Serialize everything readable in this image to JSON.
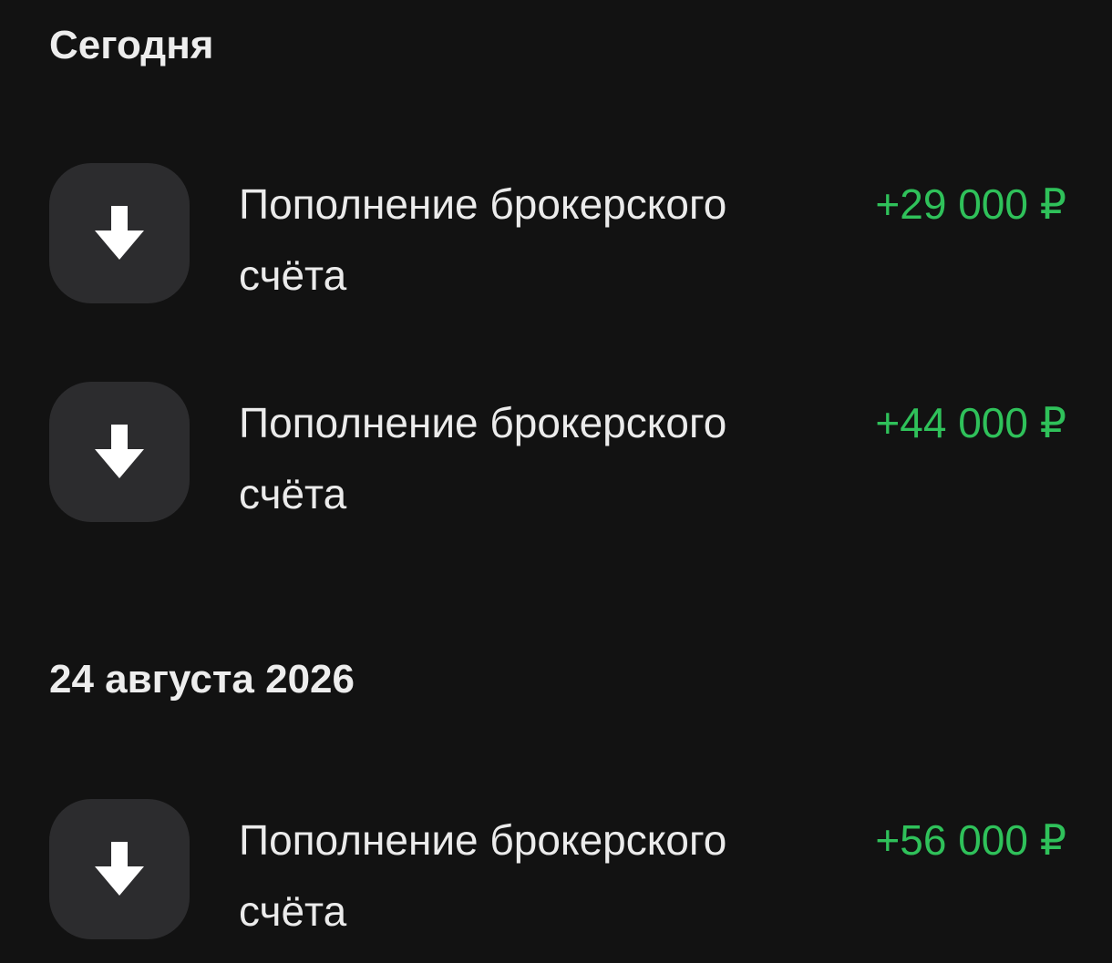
{
  "sections": [
    {
      "header": "Сегодня",
      "operations": [
        {
          "title": "Пополнение брокерского счёта",
          "amount": "+29 000 ₽",
          "icon": "arrow-down-icon"
        },
        {
          "title": "Пополнение брокерского счёта",
          "amount": "+44 000 ₽",
          "icon": "arrow-down-icon"
        }
      ]
    },
    {
      "header": "24 августа 2026",
      "operations": [
        {
          "title": "Пополнение брокерского счёта",
          "amount": "+56 000 ₽",
          "icon": "arrow-down-icon"
        }
      ]
    }
  ],
  "colors": {
    "background": "#121212",
    "icon_tile": "#2c2c2e",
    "income_amount": "#2fc15a",
    "text_primary": "#ebebeb"
  }
}
